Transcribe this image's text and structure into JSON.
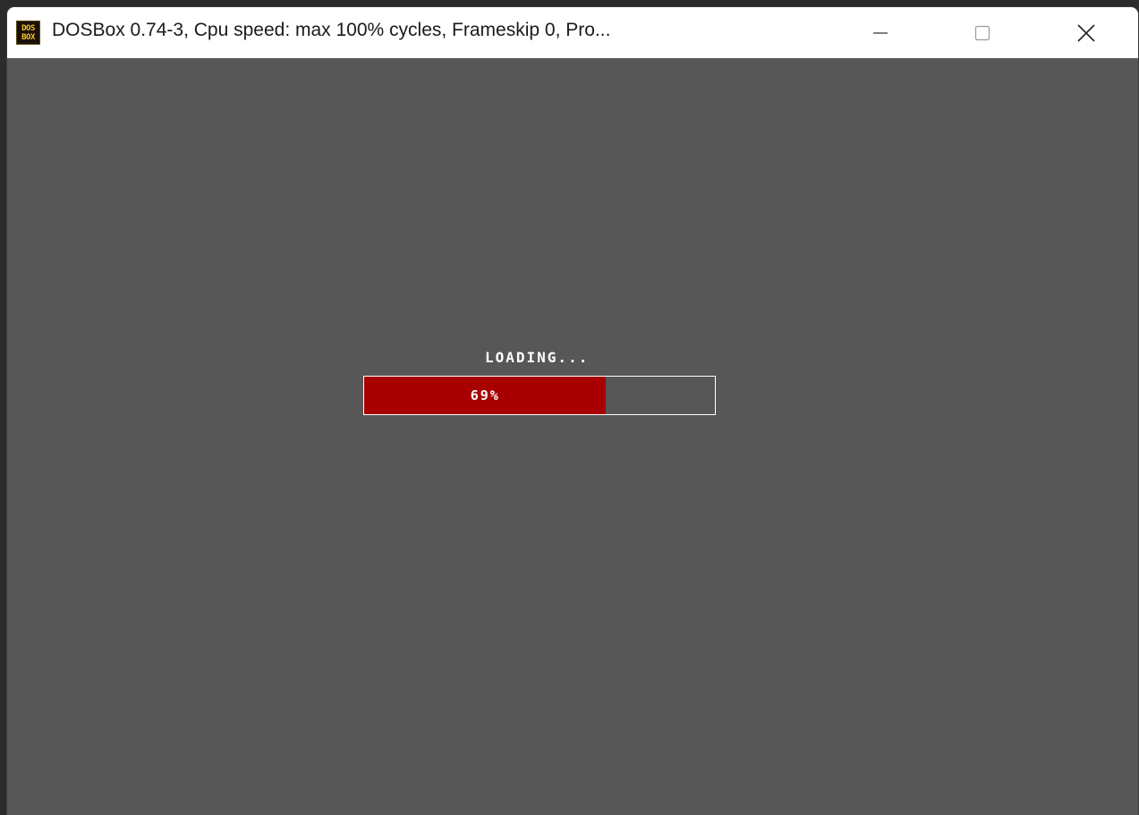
{
  "window": {
    "title": "DOSBox 0.74-3, Cpu speed: max 100% cycles, Frameskip  0, Pro...",
    "icon": {
      "name": "dosbox-icon",
      "line1": "DOS",
      "line2": "BOX"
    },
    "controls": {
      "minimize": "minimize-icon",
      "maximize": "maximize-icon",
      "close": "close-icon"
    }
  },
  "screen": {
    "background": "#575757",
    "loading_label": "LOADING...",
    "progress": {
      "value": 0.69,
      "text": "69%",
      "fill_color": "#a80000",
      "border_color": "#ffffff"
    }
  }
}
